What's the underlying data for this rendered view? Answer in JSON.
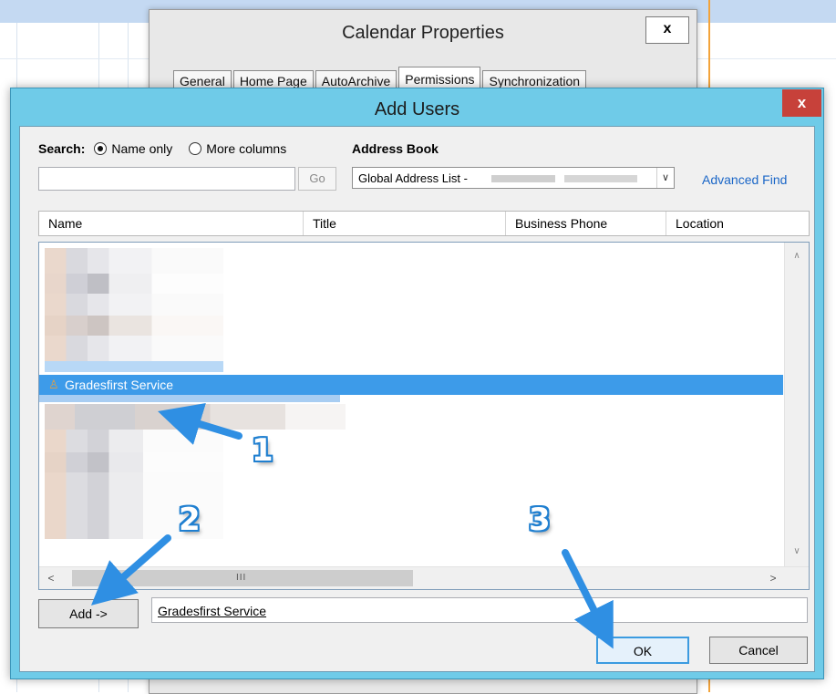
{
  "background_window": {
    "title": "Calendar Properties",
    "close_label": "x",
    "tabs": [
      "General",
      "Home Page",
      "AutoArchive",
      "Permissions",
      "Synchronization"
    ],
    "active_tab": "Permissions"
  },
  "dialog": {
    "title": "Add Users",
    "close_label": "x",
    "search_label": "Search:",
    "radio_name_only": "Name only",
    "radio_more_columns": "More columns",
    "selected_radio": "Name only",
    "address_book_label": "Address Book",
    "search_value": "",
    "go_label": "Go",
    "address_book_value": "Global Address List -",
    "advanced_find": "Advanced Find",
    "columns": [
      "Name",
      "Title",
      "Business Phone",
      "Location"
    ],
    "selected_user": "Gradesfirst Service",
    "add_button": "Add ->",
    "added_users": "Gradesfirst Service",
    "ok_button": "OK",
    "cancel_button": "Cancel",
    "hscroll_grip": "III"
  },
  "annotations": {
    "step1": "1",
    "step2": "2",
    "step3": "3",
    "arrow_color": "#2f8fe3"
  },
  "colors": {
    "dialog_frame": "#6fcbe8",
    "selection": "#3d9be9",
    "close_red": "#c7413a",
    "link": "#1a66c7"
  }
}
